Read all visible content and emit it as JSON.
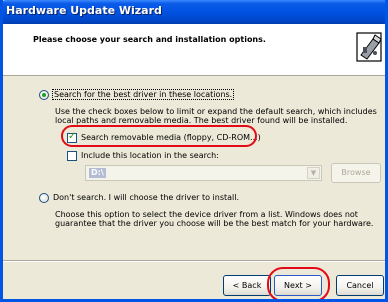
{
  "window": {
    "title": "Hardware Update Wizard"
  },
  "header": {
    "title": "Please choose your search and installation options.",
    "icon": "hardware-wizard-icon"
  },
  "options": {
    "search_best": {
      "label": "Search for the best driver in these locations.",
      "selected": true,
      "description": "Use the check boxes below to limit or expand the default search, which includes local paths and removable media. The best driver found will be installed."
    },
    "search_removable": {
      "label": "Search removable media (floppy, CD-ROM...)",
      "checked": true
    },
    "include_location": {
      "label": "Include this location in the search:",
      "checked": false
    },
    "location_combo": {
      "value": "D:\\"
    },
    "browse_label": "Browse",
    "dont_search": {
      "label": "Don't search. I will choose the driver to install.",
      "selected": false,
      "description": "Choose this option to select the device driver from a list. Windows does not guarantee that the driver you choose will be the best match for your hardware."
    }
  },
  "buttons": {
    "back": "< Back",
    "next": "Next >",
    "cancel": "Cancel"
  },
  "colors": {
    "title_bar": "#0051e0",
    "highlight_oval": "#e30b17",
    "dialog_bg": "#ece9d8"
  }
}
